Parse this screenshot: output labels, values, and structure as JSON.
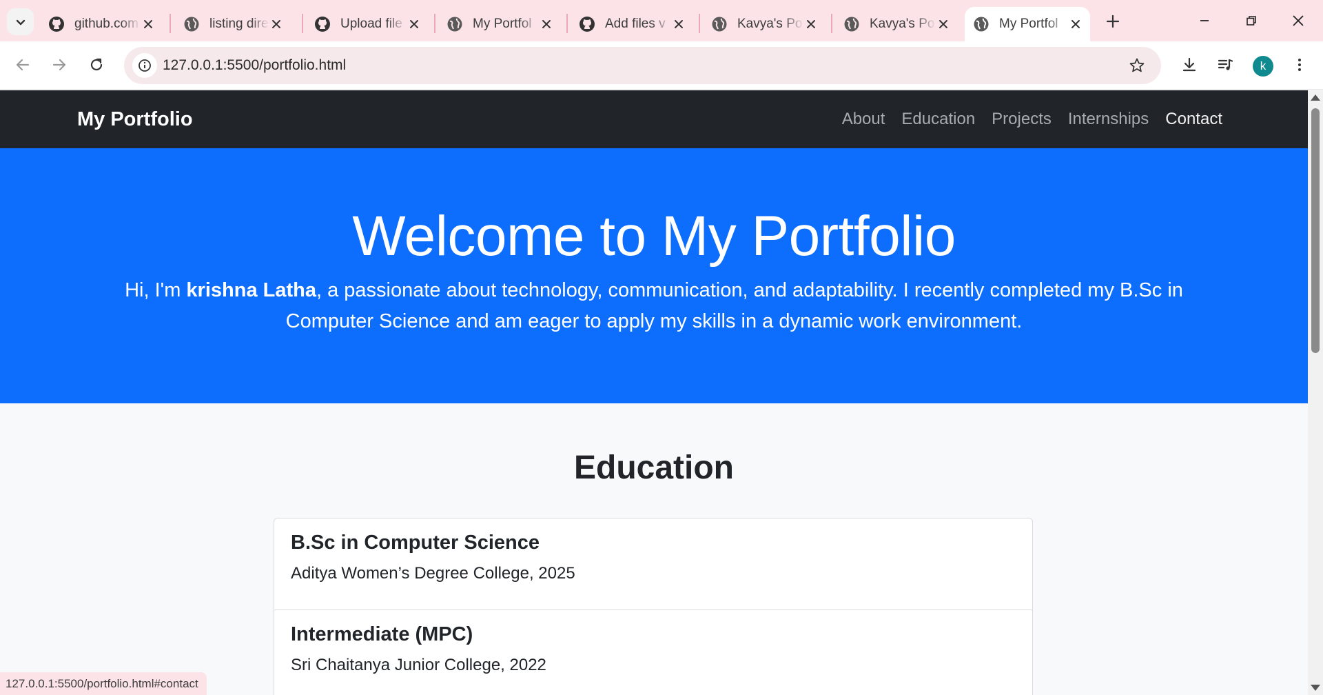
{
  "browser": {
    "tabs": [
      {
        "title": "github.com",
        "icon": "github-icon",
        "active": false
      },
      {
        "title": "listing dire",
        "icon": "globe-icon",
        "active": false
      },
      {
        "title": "Upload file",
        "icon": "github-icon",
        "active": false
      },
      {
        "title": "My Portfol",
        "icon": "globe-icon",
        "active": false
      },
      {
        "title": "Add files v",
        "icon": "github-icon",
        "active": false
      },
      {
        "title": "Kavya's Po",
        "icon": "globe-icon",
        "active": false
      },
      {
        "title": "Kavya's Po",
        "icon": "globe-icon",
        "active": false
      },
      {
        "title": "My Portfol",
        "icon": "globe-icon",
        "active": true
      }
    ],
    "address_bar": {
      "url": "127.0.0.1:5500/portfolio.html"
    },
    "profile_initial": "k",
    "status_url": "127.0.0.1:5500/portfolio.html#contact"
  },
  "site": {
    "brand": "My Portfolio",
    "nav": [
      "About",
      "Education",
      "Projects",
      "Internships",
      "Contact"
    ],
    "hero": {
      "title": "Welcome to My Portfolio",
      "intro_prefix": "Hi, I'm ",
      "name": "krishna Latha",
      "intro_suffix": ", a passionate about technology, communication, and adaptability. I recently completed my B.Sc in Computer Science and am eager to apply my skills in a dynamic work environment."
    },
    "education": {
      "heading": "Education",
      "items": [
        {
          "degree": "B.Sc in Computer Science",
          "school": "Aditya Women’s Degree College, 2025"
        },
        {
          "degree": "Intermediate (MPC)",
          "school": "Sri Chaitanya Junior College, 2022"
        }
      ]
    }
  },
  "colors": {
    "tabbar": "#fbe3e8",
    "navbar": "#212529",
    "hero": "#0d6efd",
    "avatar": "#0f8a8f"
  }
}
